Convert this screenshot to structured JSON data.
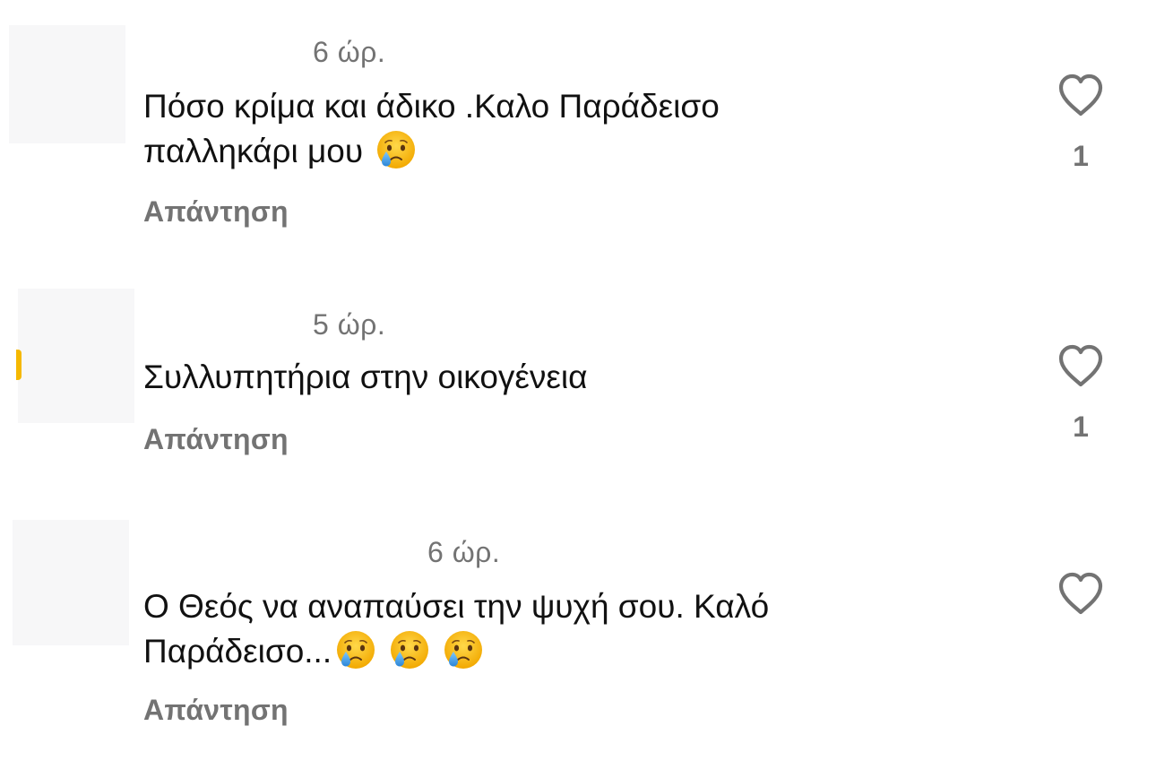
{
  "comments": [
    {
      "time": "6 ώρ.",
      "text_lines": [
        "Πόσο κρίμα και άδικο .Καλο Παράδεισο",
        "παλληκάρι μου"
      ],
      "emoji_count": 1,
      "emoji_icon": "crying-face-icon",
      "reply_label": "Απάντηση",
      "likes": "1"
    },
    {
      "time": "5 ώρ.",
      "text_lines": [
        "Συλλυπητήρια στην οικογένεια"
      ],
      "emoji_count": 0,
      "reply_label": "Απάντηση",
      "likes": "1"
    },
    {
      "time": "6 ώρ.",
      "text_lines": [
        "Ο Θεός να αναπαύσει την ψυχή σου. Καλό",
        "Παράδεισο..."
      ],
      "emoji_count": 3,
      "emoji_icon": "crying-face-icon",
      "reply_label": "Απάντηση",
      "likes": ""
    }
  ],
  "icons": {
    "like": "heart-outline-icon",
    "emoji": "crying-face-icon"
  },
  "colors": {
    "text": "#111111",
    "secondary_text": "#737373",
    "heart_outline": "#737373",
    "emoji_face": "#f5b800",
    "tear": "#4aa3e8"
  }
}
